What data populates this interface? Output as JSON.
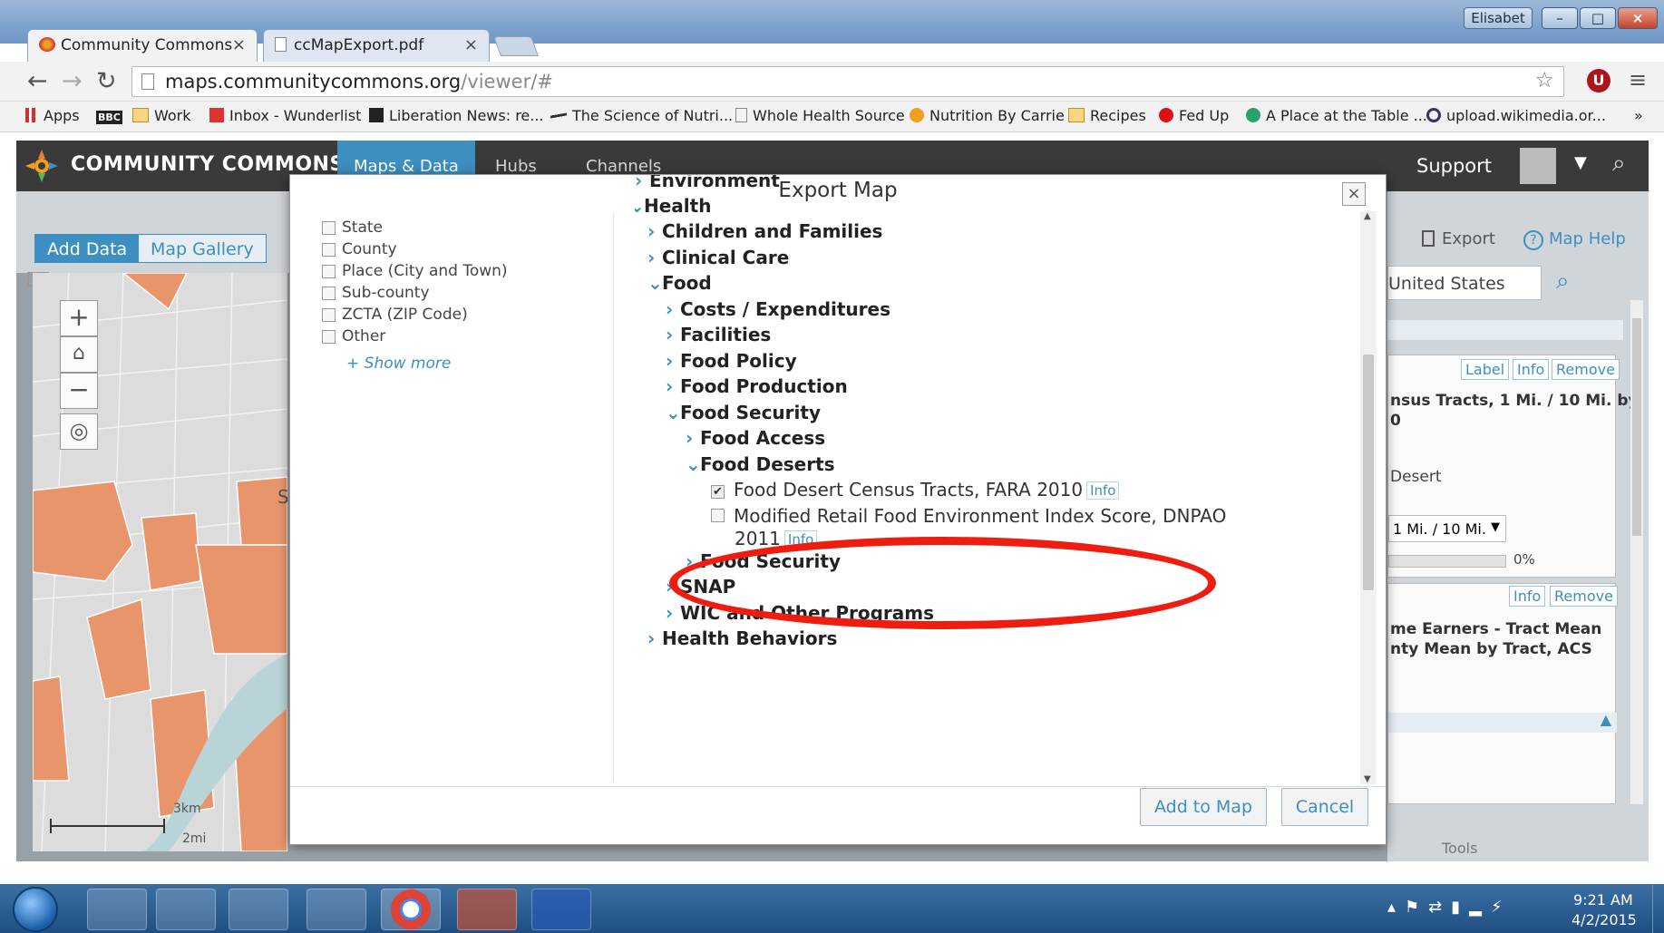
{
  "browser": {
    "tabs": [
      {
        "label": "Community Commons",
        "active": true
      },
      {
        "label": "ccMapExport.pdf",
        "active": false
      }
    ],
    "user": "Elisabet",
    "url_host": "maps.communitycommons.org",
    "url_path": "/viewer/#",
    "bookmarks": [
      "Apps",
      "Work",
      "Inbox - Wunderlist",
      "Liberation News: re...",
      "The Science of Nutri...",
      "Whole Health Source",
      "Nutrition By Carrie",
      "Recipes",
      "Fed Up",
      "A Place at the Table ...",
      "upload.wikimedia.or..."
    ],
    "overflow": "»"
  },
  "app": {
    "logo": "COMMUNITY COMMONS",
    "nav_tabs": [
      "Maps & Data",
      "Hubs",
      "Channels"
    ],
    "support": "Support",
    "left_tabs": [
      "Add Data",
      "Map Gallery"
    ],
    "map_controls": {
      "zoom_in": "+",
      "zoom_out": "−"
    },
    "map_scale": {
      "km": "3km",
      "mi": "2mi"
    },
    "map_label": "S",
    "right": {
      "export": "Export",
      "map_help": "Map Help",
      "search_value": "United States",
      "card1_buttons": [
        "Label",
        "Info",
        "Remove"
      ],
      "card1_title_lines": [
        "nsus Tracts, 1 Mi. / 10 Mi. by",
        "0"
      ],
      "card1_sub": "Desert",
      "card1_select": "1 Mi. / 10 Mi.",
      "card1_pct": "0%",
      "card2_buttons": [
        "Info",
        "Remove"
      ],
      "card2_title_lines": [
        "me Earners - Tract Mean",
        "nty Mean by Tract, ACS"
      ],
      "tools": "Tools"
    }
  },
  "modal": {
    "title": "Export Map",
    "close": "×",
    "geographies": [
      "State",
      "County",
      "Place (City and Town)",
      "Sub-county",
      "ZCTA (ZIP Code)",
      "Other"
    ],
    "show_more": "+ Show more",
    "tree_cutoff": "Environment",
    "tree": {
      "health": "Health",
      "children": "Children and Families",
      "clinical": "Clinical Care",
      "food": "Food",
      "costs": "Costs / Expenditures",
      "facilities": "Facilities",
      "policy": "Food Policy",
      "production": "Food Production",
      "security": "Food Security",
      "access": "Food Access",
      "deserts": "Food Deserts",
      "layer1": "Food Desert Census Tracts, FARA 2010",
      "layer2_l1": "Modified Retail Food Environment Index Score, DNPAO",
      "layer2_l2": "2011",
      "security2": "Food Security",
      "snap": "SNAP",
      "wic": "WIC and Other Programs",
      "behaviors": "Health Behaviors"
    },
    "info_label": "Info",
    "add_button": "Add to Map",
    "cancel_button": "Cancel"
  },
  "taskbar": {
    "time": "9:21 AM",
    "date": "4/2/2015"
  },
  "colors": {
    "accent": "#3d8fc1",
    "highlight": "#ef1d10",
    "tract_fill": "#e8956b"
  }
}
